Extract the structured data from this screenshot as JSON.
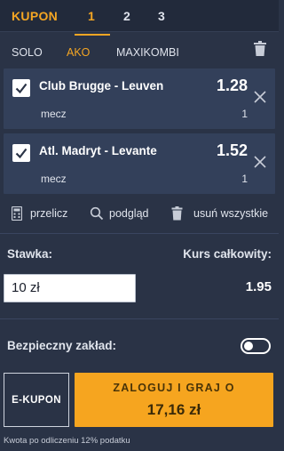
{
  "tabs": {
    "title": "KUPON",
    "numbers": [
      "1",
      "2",
      "3"
    ],
    "active_index": 0
  },
  "subtabs": [
    "SOLO",
    "AKO",
    "MAXIKOMBI"
  ],
  "active_subtab": "AKO",
  "bets": [
    {
      "match": "Club Brugge - Leuven",
      "odds": "1.28",
      "market": "mecz",
      "pick": "1"
    },
    {
      "match": "Atl. Madryt - Levante",
      "odds": "1.52",
      "market": "mecz",
      "pick": "1"
    }
  ],
  "actions": {
    "recalc": "przelicz",
    "preview": "podgląd",
    "remove_all": "usuń wszystkie"
  },
  "stake": {
    "label": "Stawka:",
    "value": "10 zł",
    "total_odds_label": "Kurs całkowity:",
    "total_odds": "1.95"
  },
  "safe_bet": {
    "label": "Bezpieczny zakład:",
    "enabled": false
  },
  "buttons": {
    "ekupon": "E-KUPON",
    "login_line1": "ZALOGUJ I GRAJ O",
    "login_amount": "17,16 zł"
  },
  "footnote": "Kwota po odliczeniu 12% podatku",
  "colors": {
    "accent": "#f5a623",
    "background": "#2a3346",
    "card": "#33405a",
    "button": "#f6a51f"
  }
}
